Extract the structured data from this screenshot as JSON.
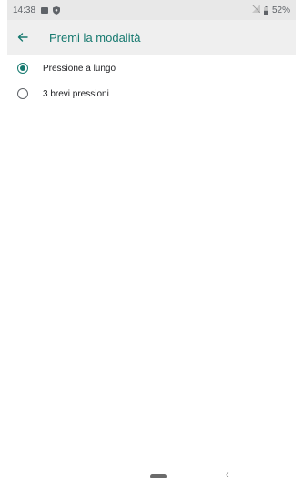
{
  "status_bar": {
    "time": "14:38",
    "battery": "52%",
    "icons": [
      "notification-icon",
      "shield-icon",
      "signal-off-icon",
      "battery-icon"
    ]
  },
  "app_bar": {
    "title": "Premi la modalità",
    "back_icon": "arrow-left-icon"
  },
  "options": [
    {
      "label": "Pressione a lungo",
      "checked": true
    },
    {
      "label": "3 brevi pressioni",
      "checked": false
    }
  ],
  "nav_bar": {
    "home_icon": "home-pill-icon",
    "back_glyph": "‹"
  },
  "colors": {
    "accent": "#16796f",
    "status_bar": "#e8e8e8",
    "app_bar": "#efefef"
  }
}
